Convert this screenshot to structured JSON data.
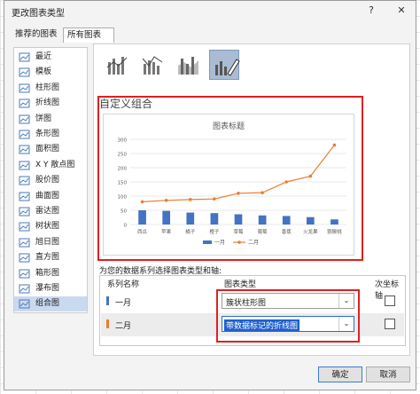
{
  "dialog": {
    "title": "更改图表类型",
    "help": "?",
    "close": "✕"
  },
  "tabs": [
    {
      "label": "推荐的图表"
    },
    {
      "label": "所有图表"
    }
  ],
  "left_items": [
    {
      "label": "最近"
    },
    {
      "label": "模板"
    },
    {
      "label": "柱形图"
    },
    {
      "label": "折线图"
    },
    {
      "label": "饼图"
    },
    {
      "label": "条形图"
    },
    {
      "label": "面积图"
    },
    {
      "label": "X Y 散点图"
    },
    {
      "label": "股价图"
    },
    {
      "label": "曲面图"
    },
    {
      "label": "雷达图"
    },
    {
      "label": "树状图"
    },
    {
      "label": "旭日图"
    },
    {
      "label": "直方图"
    },
    {
      "label": "箱形图"
    },
    {
      "label": "瀑布图"
    },
    {
      "label": "组合图"
    }
  ],
  "section_title": "自定义组合",
  "chart_data": {
    "type": "bar",
    "title": "图表标题",
    "categories": [
      "西瓜",
      "苹果",
      "橘子",
      "橙子",
      "草莓",
      "葡萄",
      "香蕉",
      "火龙果",
      "猕猴桃"
    ],
    "series": [
      {
        "name": "一月",
        "type": "bar",
        "color": "#4472c4",
        "values": [
          50,
          48,
          42,
          40,
          36,
          32,
          30,
          26,
          18
        ]
      },
      {
        "name": "二月",
        "type": "line",
        "color": "#ed7d31",
        "values": [
          80,
          85,
          88,
          90,
          110,
          112,
          150,
          170,
          280
        ]
      }
    ],
    "ylim": [
      0,
      300
    ],
    "yticks": [
      "0",
      "50",
      "100",
      "150",
      "200",
      "250",
      "300"
    ],
    "legend": "bottom",
    "grid": true
  },
  "hint": "为您的数据系列选择图表类型和轴:",
  "table": {
    "headers": [
      "系列名称",
      "图表类型",
      "次坐标轴"
    ],
    "rows": [
      {
        "name": "一月",
        "color": "#4472c4",
        "type": "簇状柱形图"
      },
      {
        "name": "二月",
        "color": "#ed7d31",
        "type": "带数据标记的折线图"
      }
    ]
  },
  "buttons": {
    "ok": "确定",
    "cancel": "取消"
  },
  "caret": "⌄"
}
